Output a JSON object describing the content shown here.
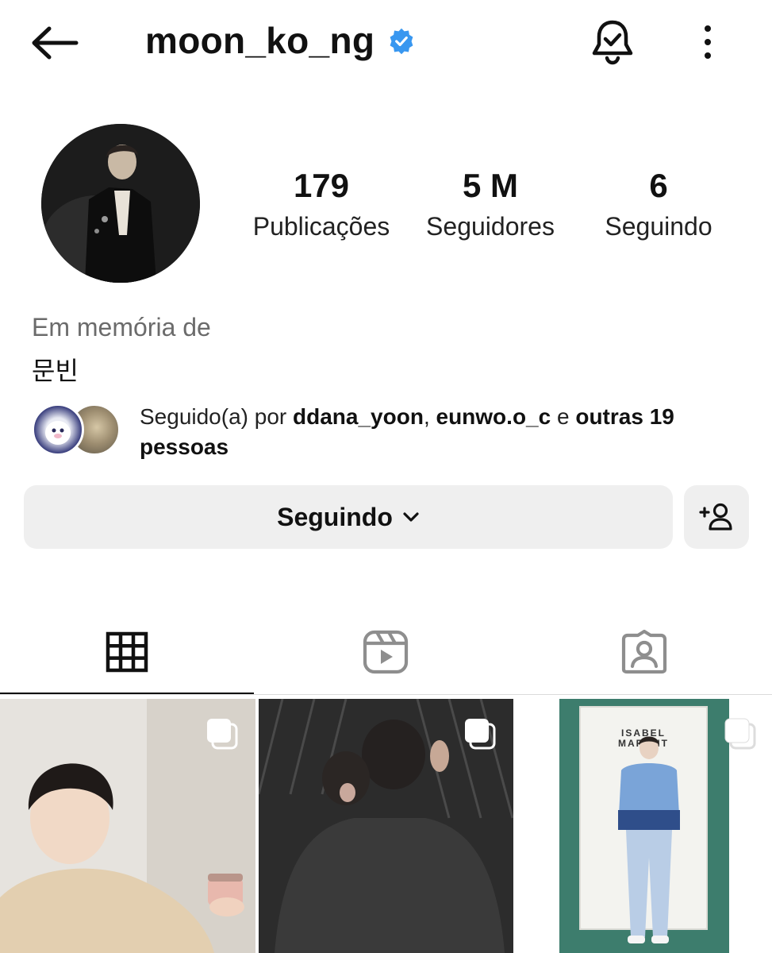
{
  "header": {
    "username": "moon_ko_ng",
    "verified": true
  },
  "profile": {
    "stats": {
      "posts_count": "179",
      "posts_label": "Publicações",
      "followers_count": "5 M",
      "followers_label": "Seguidores",
      "following_count": "6",
      "following_label": "Seguindo"
    },
    "memorial_label": "Em memória de",
    "full_name": "문빈"
  },
  "followed_by": {
    "prefix": "Seguido(a) por ",
    "user1": "ddana_yoon",
    "separator": ", ",
    "user2": "eunwo.o_c",
    "conjunction": " e ",
    "others": "outras 19 pessoas"
  },
  "actions": {
    "following_button_label": "Seguindo"
  },
  "tabs": [
    {
      "name": "grid",
      "active": true
    },
    {
      "name": "reels",
      "active": false
    },
    {
      "name": "tagged",
      "active": false
    }
  ],
  "posts": [
    {
      "type": "carousel",
      "description_icon": "carousel-icon"
    },
    {
      "type": "carousel",
      "description_icon": "carousel-icon"
    },
    {
      "type": "carousel",
      "description_icon": "carousel-icon",
      "visible_text": "ISABEL MARANT"
    }
  ],
  "colors": {
    "verified_badge": "#3897f0",
    "button_bg": "#efefef",
    "text_primary": "#111111",
    "text_secondary": "#6b6b6b"
  }
}
